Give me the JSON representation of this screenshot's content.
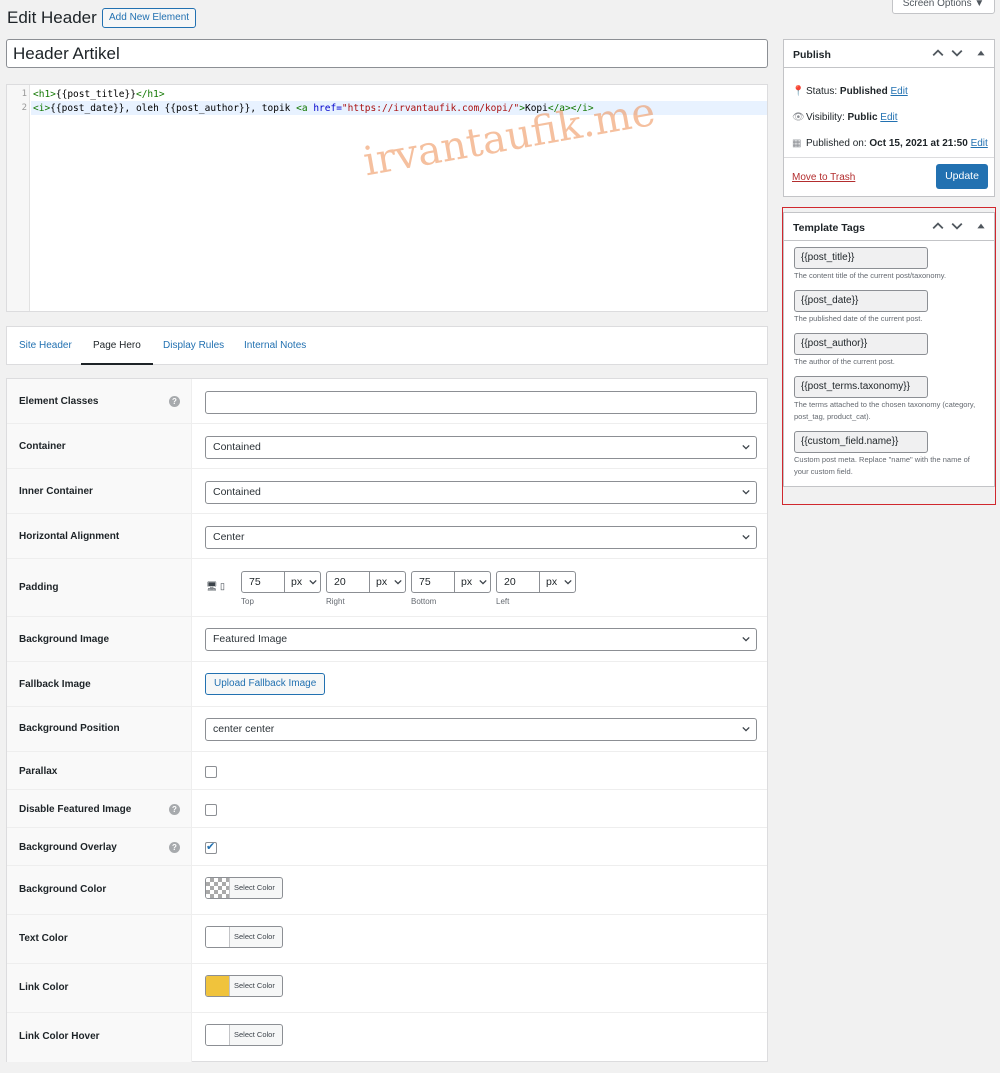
{
  "header": {
    "page_title": "Edit Header",
    "add_new_label": "Add New Element",
    "screen_options_label": "Screen Options ▼",
    "title_value": "Header Artikel"
  },
  "editor": {
    "line_numbers": [
      "1",
      "2"
    ],
    "watermark": "irvantaufik.me"
  },
  "tabs": [
    {
      "label": "Site Header"
    },
    {
      "label": "Page Hero"
    },
    {
      "label": "Display Rules"
    },
    {
      "label": "Internal Notes"
    }
  ],
  "settings": {
    "element_classes": {
      "label": "Element Classes",
      "value": ""
    },
    "container": {
      "label": "Container",
      "value": "Contained"
    },
    "inner_container": {
      "label": "Inner Container",
      "value": "Contained"
    },
    "horizontal_alignment": {
      "label": "Horizontal Alignment",
      "value": "Center"
    },
    "padding": {
      "label": "Padding",
      "top": {
        "value": "75",
        "unit": "px",
        "caption": "Top"
      },
      "right": {
        "value": "20",
        "unit": "px",
        "caption": "Right"
      },
      "bottom": {
        "value": "75",
        "unit": "px",
        "caption": "Bottom"
      },
      "left": {
        "value": "20",
        "unit": "px",
        "caption": "Left"
      }
    },
    "background_image": {
      "label": "Background Image",
      "value": "Featured Image"
    },
    "fallback_image": {
      "label": "Fallback Image",
      "button": "Upload Fallback Image"
    },
    "background_position": {
      "label": "Background Position",
      "value": "center center"
    },
    "parallax": {
      "label": "Parallax",
      "checked": false
    },
    "disable_featured_image": {
      "label": "Disable Featured Image",
      "checked": false
    },
    "background_overlay": {
      "label": "Background Overlay",
      "checked": true,
      "check_glyph": "✔"
    },
    "background_color": {
      "label": "Background Color",
      "button": "Select Color",
      "swatch": "transparent"
    },
    "text_color": {
      "label": "Text Color",
      "button": "Select Color",
      "swatch": "#ffffff"
    },
    "link_color": {
      "label": "Link Color",
      "button": "Select Color",
      "swatch": "#f0c33c"
    },
    "link_color_hover": {
      "label": "Link Color Hover",
      "button": "Select Color",
      "swatch": "#ffffff"
    }
  },
  "publish": {
    "title": "Publish",
    "status_label": "Status:",
    "status_value": "Published",
    "visibility_label": "Visibility:",
    "visibility_value": "Public",
    "published_label": "Published on:",
    "published_value": "Oct 15, 2021 at 21:50",
    "edit_link": "Edit",
    "trash_label": "Move to Trash",
    "update_label": "Update"
  },
  "template_tags": {
    "title": "Template Tags",
    "items": [
      {
        "tag": "{{post_title}}",
        "desc": "The content title of the current post/taxonomy."
      },
      {
        "tag": "{{post_date}}",
        "desc": "The published date of the current post."
      },
      {
        "tag": "{{post_author}}",
        "desc": "The author of the current post."
      },
      {
        "tag": "{{post_terms.taxonomy}}",
        "desc": "The terms attached to the chosen taxonomy (category, post_tag, product_cat)."
      },
      {
        "tag": "{{custom_field.name}}",
        "desc": "Custom post meta. Replace \"name\" with the name of your custom field."
      }
    ]
  },
  "colors": {
    "accent": "#2271b1",
    "highlight_border": "#d0282e",
    "trash": "#b32d2e"
  }
}
